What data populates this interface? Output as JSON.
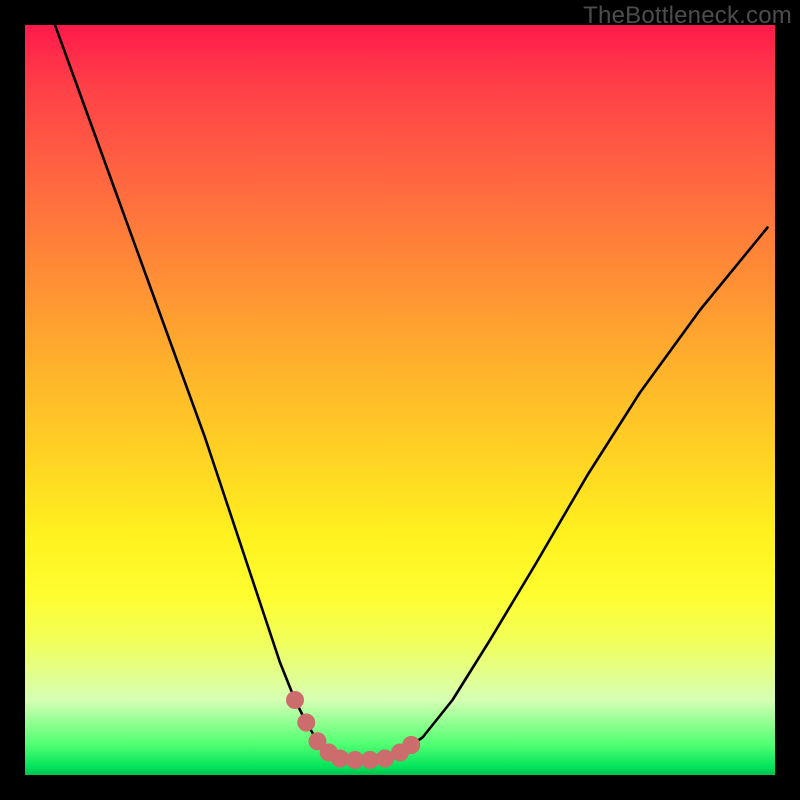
{
  "watermark": "TheBottleneck.com",
  "chart_data": {
    "type": "line",
    "title": "",
    "xlabel": "",
    "ylabel": "",
    "x_range": [
      0,
      100
    ],
    "y_range": [
      0,
      100
    ],
    "series": [
      {
        "name": "bottleneck-curve",
        "x": [
          4,
          8,
          12,
          16,
          20,
          24,
          27,
          30,
          32,
          34,
          36,
          37.5,
          39,
          40.5,
          42,
          44,
          46,
          48,
          50,
          53,
          57,
          62,
          68,
          75,
          82,
          90,
          99
        ],
        "y": [
          100,
          89,
          78,
          67,
          56,
          45,
          36,
          27,
          21,
          15,
          10,
          7,
          4.5,
          3,
          2.2,
          2,
          2,
          2.2,
          3,
          5,
          10,
          18,
          28,
          40,
          51,
          62,
          73
        ],
        "stroke": "#000000",
        "stroke_width": 2.6
      }
    ],
    "markers": {
      "name": "highlight-dots",
      "fill": "#cc6c6c",
      "radius": 9,
      "points": [
        {
          "x": 36,
          "y": 10
        },
        {
          "x": 37.5,
          "y": 7
        },
        {
          "x": 39,
          "y": 4.5
        },
        {
          "x": 40.5,
          "y": 3
        },
        {
          "x": 42,
          "y": 2.2
        },
        {
          "x": 44,
          "y": 2
        },
        {
          "x": 46,
          "y": 2
        },
        {
          "x": 48,
          "y": 2.2
        },
        {
          "x": 50,
          "y": 3
        },
        {
          "x": 51.5,
          "y": 4
        }
      ]
    },
    "gradient_stops": [
      {
        "pos": 0,
        "color": "#ff1a4b"
      },
      {
        "pos": 22,
        "color": "#ff6b3f"
      },
      {
        "pos": 46,
        "color": "#ffb32b"
      },
      {
        "pos": 68,
        "color": "#fff11f"
      },
      {
        "pos": 90,
        "color": "#d6ffb4"
      },
      {
        "pos": 100,
        "color": "#00c04c"
      }
    ]
  }
}
